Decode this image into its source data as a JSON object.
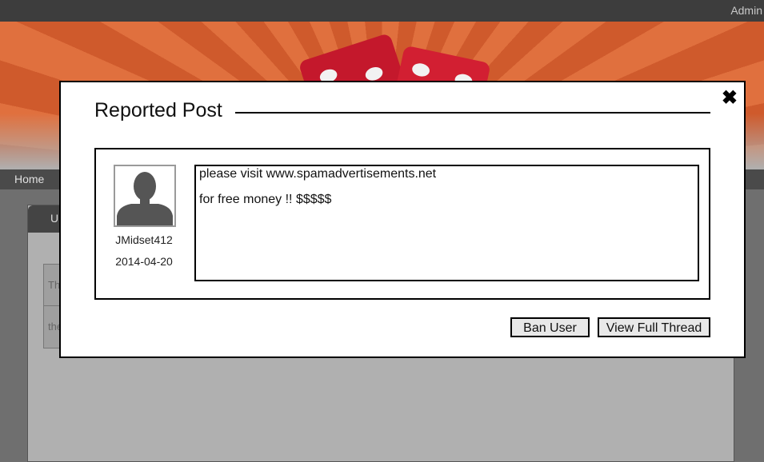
{
  "topbar": {
    "user_label": "Admin"
  },
  "nav": {
    "home_label": "Home"
  },
  "background": {
    "tab_label": "U",
    "table_rows": [
      "Th",
      "the"
    ]
  },
  "modal": {
    "title": "Reported Post",
    "close_icon": "close-x-icon",
    "post": {
      "username": "JMidset412",
      "date": "2014-04-20",
      "lines": [
        "please visit www.spamadvertisements.net",
        "for free money !! $$$$$"
      ]
    },
    "buttons": {
      "ban_label": "Ban User",
      "view_thread_label": "View Full Thread"
    }
  },
  "colors": {
    "banner": "#e0703e",
    "topbar": "#3d3d3d",
    "overlay": "#6f6f6f"
  }
}
